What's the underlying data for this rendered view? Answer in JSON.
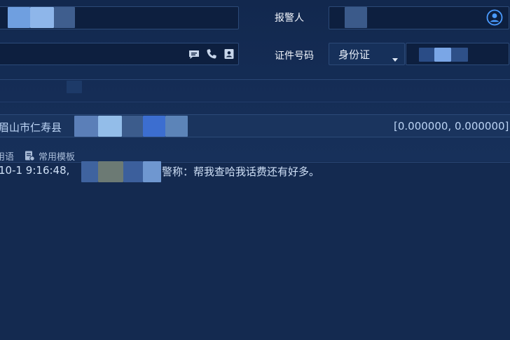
{
  "reporter": {
    "label": "报警人"
  },
  "id_number": {
    "label": "证件号码",
    "type_selected": "身份证"
  },
  "location": {
    "address_prefix": "眉山市仁寿县",
    "coordinates": "[0.000000, 0.000000]"
  },
  "toolbar": {
    "phrases_label": "用语",
    "templates_label": "常用模板"
  },
  "message": {
    "timestamp": "10-1 9:16:48,",
    "text": "警称：帮我查哈我话费还有好多。"
  },
  "colors": {
    "background": "#142a52",
    "field_border": "#2c4a78",
    "accent": "#4a9bff"
  }
}
